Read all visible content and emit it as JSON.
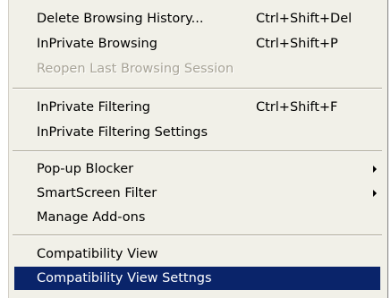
{
  "menu": {
    "items": [
      {
        "label": "Delete Browsing History...",
        "shortcut": "Ctrl+Shift+Del",
        "disabled": false
      },
      {
        "label": "InPrivate Browsing",
        "shortcut": "Ctrl+Shift+P",
        "disabled": false
      },
      {
        "label": "Reopen Last Browsing Session",
        "shortcut": "",
        "disabled": true
      },
      {
        "label": "InPrivate Filtering",
        "shortcut": "Ctrl+Shift+F",
        "disabled": false
      },
      {
        "label": "InPrivate Filtering Settings",
        "shortcut": "",
        "disabled": false
      },
      {
        "label": "Pop-up Blocker",
        "shortcut": "",
        "submenu": true,
        "disabled": false
      },
      {
        "label": "SmartScreen Filter",
        "shortcut": "",
        "submenu": true,
        "disabled": false
      },
      {
        "label": "Manage Add-ons",
        "shortcut": "",
        "disabled": false
      },
      {
        "label": "Compatibility View",
        "shortcut": "",
        "disabled": false
      },
      {
        "label": "Compatibility View Settngs",
        "shortcut": "",
        "disabled": false,
        "selected": true
      }
    ]
  },
  "colors": {
    "menu_background": "#f1f0e8",
    "selection_background": "#0a246a",
    "selection_text": "#ffffff",
    "disabled_text": "#a8a497"
  },
  "icons": {
    "submenu_arrow": "chevron-right-icon"
  }
}
